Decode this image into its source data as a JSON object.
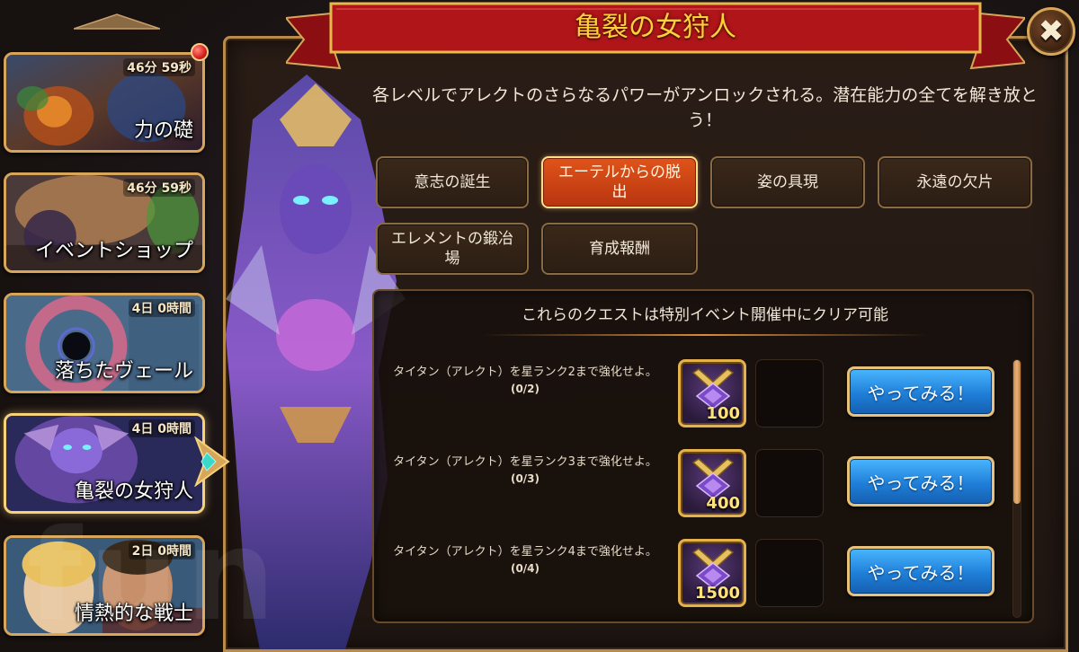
{
  "header": {
    "title": "亀裂の女狩人",
    "close_symbol": "✖"
  },
  "description": "各レベルでアレクトのさらなるパワーがアンロックされる。潜在能力の全てを解き放とう！",
  "tabs": [
    {
      "label": "意志の誕生",
      "active": false
    },
    {
      "label": "エーテルからの脱出",
      "active": true
    },
    {
      "label": "姿の具現",
      "active": false
    },
    {
      "label": "永遠の欠片",
      "active": false
    },
    {
      "label": "エレメントの鍛冶場",
      "active": false
    },
    {
      "label": "育成報酬",
      "active": false
    }
  ],
  "events": [
    {
      "title": "力の礎",
      "timer": "46分 59秒",
      "has_notification": true,
      "active": false
    },
    {
      "title": "イベントショップ",
      "timer": "46分 59秒",
      "has_notification": false,
      "active": false
    },
    {
      "title": "落ちたヴェール",
      "timer": "4日 0時間",
      "has_notification": false,
      "active": false
    },
    {
      "title": "亀裂の女狩人",
      "timer": "4日 0時間",
      "has_notification": false,
      "active": true
    },
    {
      "title": "情熱的な戦士",
      "timer": "2日 0時間",
      "has_notification": false,
      "active": false
    }
  ],
  "quests": {
    "header": "これらのクエストは特別イベント開催中にクリア可能",
    "items": [
      {
        "text": "タイタン（アレクト）を星ランク2まで強化せよ。",
        "progress": "(0/2)",
        "reward_qty": "100",
        "button": "やってみる！"
      },
      {
        "text": "タイタン（アレクト）を星ランク3まで強化せよ。",
        "progress": "(0/3)",
        "reward_qty": "400",
        "button": "やってみる！"
      },
      {
        "text": "タイタン（アレクト）を星ランク4まで強化せよ。",
        "progress": "(0/4)",
        "reward_qty": "1500",
        "button": "やってみる！"
      }
    ]
  },
  "watermark": "fun",
  "colors": {
    "accent_gold": "#d7a65a",
    "banner_red": "#b0151a",
    "title_yellow": "#ffd23a",
    "active_tab": "#e0541a",
    "button_blue": "#1f7fd8"
  },
  "icons": {
    "close": "close-icon",
    "reward": "titan-emblem-icon",
    "notification": "notification-dot-icon",
    "pointer": "gem-pointer-icon",
    "scroll_up": "chevron-up-icon"
  }
}
